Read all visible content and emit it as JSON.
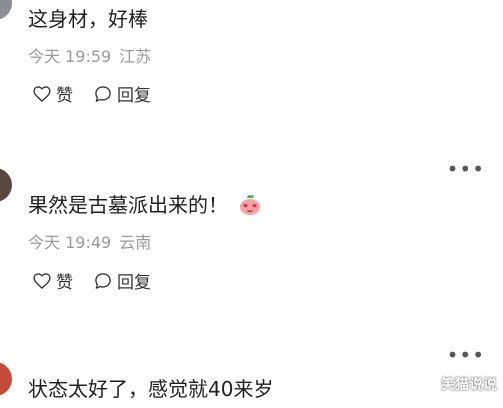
{
  "comments": [
    {
      "text": "这身材，好棒",
      "time": "今天 19:59",
      "location": "江苏",
      "like_label": "赞",
      "reply_label": "回复"
    },
    {
      "text": "果然是古墓派出来的！",
      "time": "今天 19:49",
      "location": "云南",
      "like_label": "赞",
      "reply_label": "回复",
      "emoji": "heart-eyes-peach-emoji"
    },
    {
      "text": "状态太好了，感觉就40来岁"
    }
  ],
  "more_label": "•••",
  "watermark": "笑猫说说",
  "icons": {
    "like": "heart-outline-icon",
    "reply": "speech-bubble-icon",
    "more": "more-dots-icon"
  }
}
